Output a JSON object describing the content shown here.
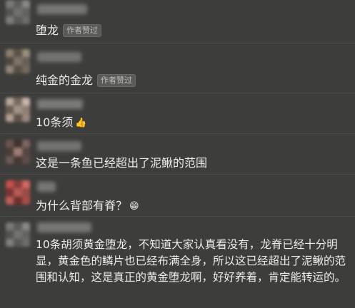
{
  "comments": [
    {
      "text": "堕龙",
      "badge": "作者赞过"
    },
    {
      "text": "纯金的金龙",
      "badge": "作者赞过"
    },
    {
      "text": "10条须",
      "emoji": "👍"
    },
    {
      "text": "这是一条鱼已经超出了泥鳅的范围"
    },
    {
      "text": "为什么背部有脊？",
      "emoji": "😁"
    },
    {
      "text": "10条胡须黄金堕龙，不知道大家认真看没有，龙脊已经十分明显，黄金色的鳞片也已经布满全身，所以这已经超出了泥鳅的范围和认知，这是真正的黄金堕龙啊，好好养着，肯定能转运的。"
    }
  ]
}
